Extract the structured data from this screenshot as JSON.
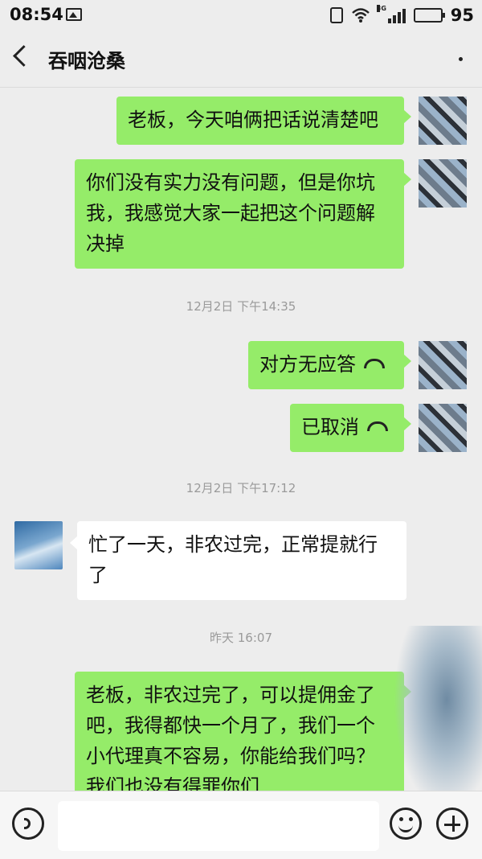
{
  "status_bar": {
    "time": "08:54",
    "network": "3G",
    "battery": "95",
    "battery_level": 0.95
  },
  "header": {
    "title": "吞咽沧桑"
  },
  "messages": [
    {
      "from": "me",
      "text": "老板，今天咱俩把话说清楚吧"
    },
    {
      "from": "me",
      "text": "你们没有实力没有问题，但是你坑我，我感觉大家一起把这个问题解决掉"
    },
    {
      "timestamp": "12月2日 下午14:35"
    },
    {
      "from": "me",
      "text": "对方无应答",
      "icon": "phone-hangup-icon"
    },
    {
      "from": "me",
      "text": "已取消",
      "icon": "phone-hangup-icon"
    },
    {
      "timestamp": "12月2日 下午17:12"
    },
    {
      "from": "other",
      "text": "忙了一天，非农过完，正常提就行了"
    },
    {
      "timestamp": "昨天 16:07"
    },
    {
      "from": "me",
      "text": "老板，非农过完了，可以提佣金了吧，我得都快一个月了，我们一个小代理真不容易，你能给我们吗？我们也没有得罪你们"
    }
  ],
  "input": {
    "value": ""
  }
}
